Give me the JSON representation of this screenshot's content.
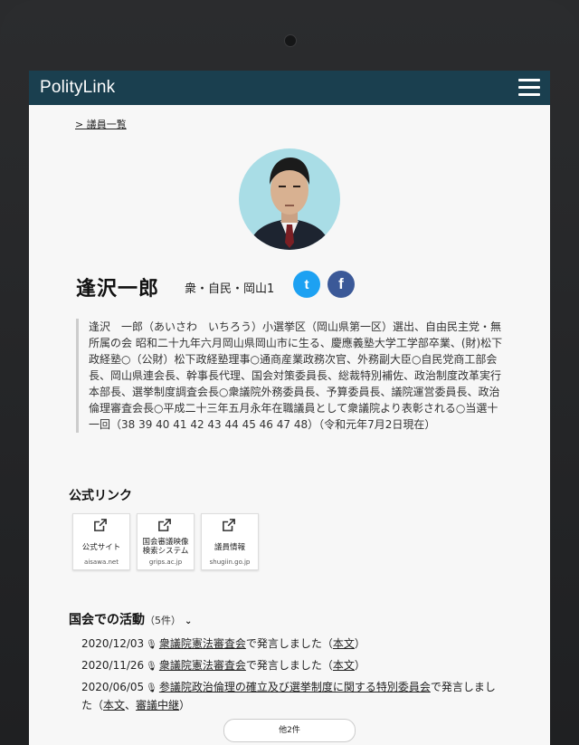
{
  "app": {
    "brand": "PolityLink"
  },
  "breadcrumb": {
    "label": "> 議員一覧"
  },
  "profile": {
    "name": "逢沢一郎",
    "affiliation": "衆・自民・岡山1",
    "sns": {
      "twitter_icon": "t",
      "facebook_icon": "f"
    },
    "bio": "逢沢　一郎（あいさわ　いちろう）小選挙区（岡山県第一区）選出、自由民主党・無所属の会 昭和二十九年六月岡山県岡山市に生る、慶應義塾大学工学部卒業、(財)松下政経塾○（公財）松下政経塾理事○通商産業政務次官、外務副大臣○自民党商工部会長、岡山県連会長、幹事長代理、国会対策委員長、総裁特別補佐、政治制度改革実行本部長、選挙制度調査会長○衆議院外務委員長、予算委員長、議院運営委員長、政治倫理審査会長○平成二十三年五月永年在職議員として衆議院より表彰される○当選十一回（38 39 40 41 42 43 44 45 46 47 48）（令和元年7月2日現在）"
  },
  "links": {
    "title": "公式リンク",
    "items": [
      {
        "label": "公式サイト",
        "domain": "aisawa.net"
      },
      {
        "label1": "国会審議映像",
        "label2": "検索システム",
        "domain": "grips.ac.jp"
      },
      {
        "label": "議員情報",
        "domain": "shugiin.go.jp"
      }
    ]
  },
  "activity": {
    "title": "国会での活動",
    "count": "（5件）",
    "items": [
      {
        "date": "2020/12/03",
        "committee": "衆議院憲法審査会",
        "text": "で発言しました（",
        "link": "本文",
        "close": "）"
      },
      {
        "date": "2020/11/26",
        "committee": "衆議院憲法審査会",
        "text": "で発言しました（",
        "link": "本文",
        "close": "）"
      },
      {
        "date": "2020/06/05",
        "committee": "参議院政治倫理の確立及び選挙制度に関する特別委員会",
        "text": "で発言しました（",
        "link": "本文",
        "sep": "、",
        "link2": "審議中継",
        "close": "）"
      }
    ],
    "more_label": "他2件"
  },
  "colors": {
    "navbar": "#1a3f4f",
    "twitter": "#1da1f2",
    "facebook": "#3b5998",
    "avatar_bg": "#a9dde6"
  }
}
